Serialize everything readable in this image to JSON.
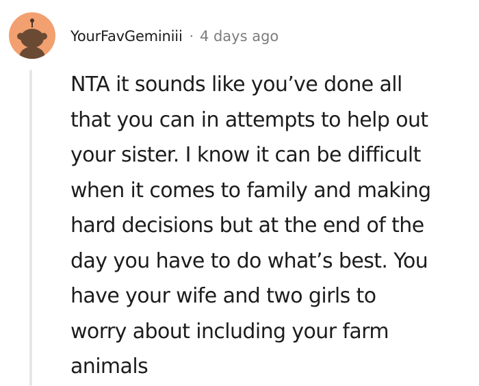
{
  "comment": {
    "author": "YourFavGeminiii",
    "separator": "·",
    "timestamp": "4 days ago",
    "avatar_icon": "snoo-avatar-icon",
    "avatar_color": "#f2a070",
    "body_lines": [
      "NTA it sounds like you’ve done all",
      "that you can in attempts to help out",
      "your sister. I know it can be difficult",
      "when it comes to family and making",
      "hard decisions but at the end of the",
      "day you have to do what’s best. You",
      "have your wife and two girls to",
      "worry about including your farm",
      "animals"
    ]
  }
}
